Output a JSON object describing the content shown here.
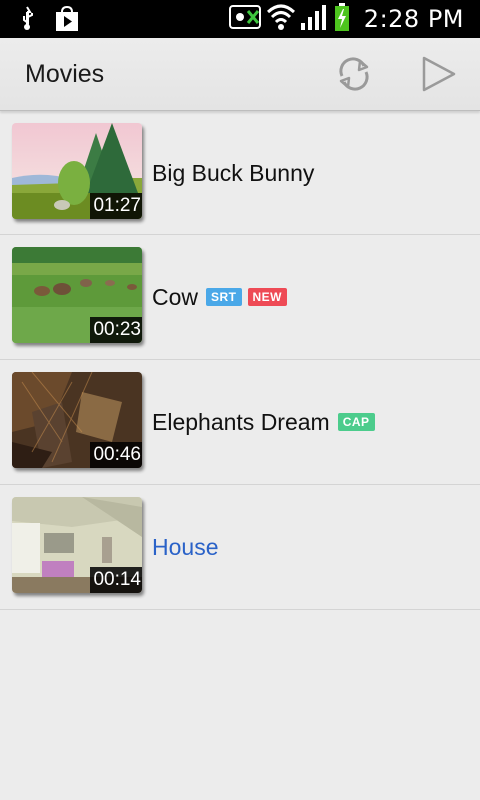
{
  "status_bar": {
    "time": "2:28 PM",
    "icons": [
      "usb-icon",
      "store-icon",
      "vpn-icon",
      "wifi-icon",
      "signal-icon",
      "battery-charging-icon"
    ]
  },
  "action_bar": {
    "title": "Movies",
    "actions": [
      {
        "name": "refresh",
        "icon": "refresh-icon"
      },
      {
        "name": "play",
        "icon": "play-icon"
      }
    ]
  },
  "movies": [
    {
      "title": "Big Buck Bunny",
      "duration": "01:27",
      "badges": [],
      "highlighted": false
    },
    {
      "title": "Cow",
      "duration": "00:23",
      "badges": [
        {
          "text": "SRT",
          "color": "#4aa8e8"
        },
        {
          "text": "NEW",
          "color": "#ee4a55"
        }
      ],
      "highlighted": false
    },
    {
      "title": "Elephants Dream",
      "duration": "00:46",
      "badges": [
        {
          "text": "CAP",
          "color": "#4ccc8c"
        }
      ],
      "highlighted": false
    },
    {
      "title": "House",
      "duration": "00:14",
      "badges": [],
      "highlighted": true
    }
  ],
  "colors": {
    "highlight_text": "#2a62c8",
    "srt_badge": "#4aa8e8",
    "new_badge": "#ee4a55",
    "cap_badge": "#4ccc8c"
  }
}
